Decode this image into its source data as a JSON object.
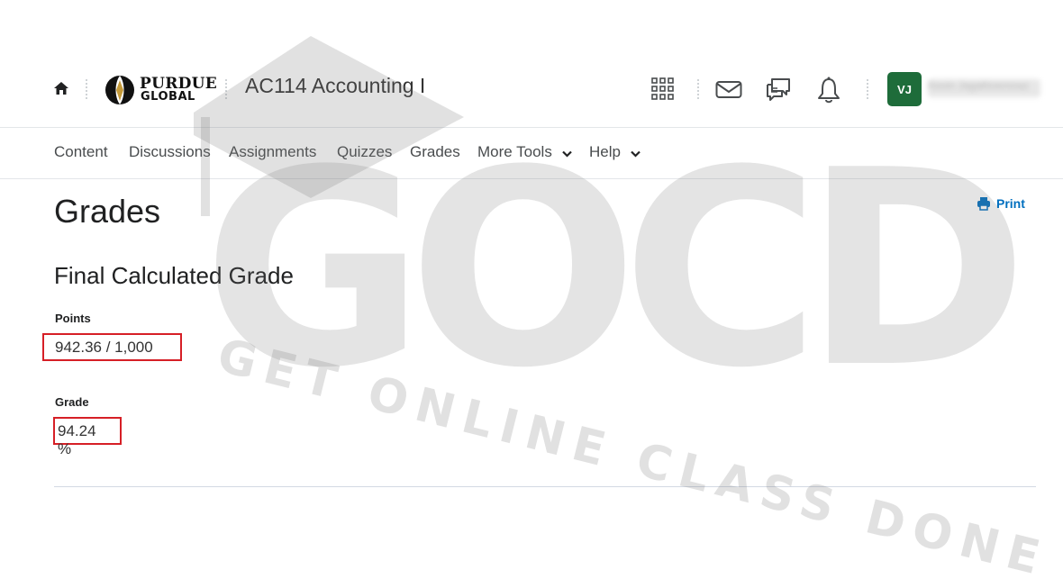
{
  "header": {
    "logo_line1": "PURDUE",
    "logo_line2": "GLOBAL",
    "course_title": "AC114 Accounting I",
    "user_initials": "VJ",
    "user_name": "Kevin Jagathnemnaz"
  },
  "nav": {
    "items": [
      "Content",
      "Discussions",
      "Assignments",
      "Quizzes",
      "Grades",
      "More Tools",
      "Help"
    ]
  },
  "main": {
    "page_title": "Grades",
    "print_label": "Print",
    "section_title": "Final Calculated Grade",
    "points_label": "Points",
    "points_value": "942.36 / 1,000",
    "grade_label": "Grade",
    "grade_value": "94.24 %"
  },
  "watermark": {
    "big_text": "GOCD",
    "tagline": "GET ONLINE CLASS DONE"
  },
  "colors": {
    "avatar_bg": "#1e6c3a",
    "link": "#006fbf",
    "highlight_border": "#d61f26"
  },
  "icons": [
    "home-icon",
    "waffle-icon",
    "mail-icon",
    "chat-icon",
    "bell-icon",
    "print-icon",
    "chevron-down-icon"
  ]
}
